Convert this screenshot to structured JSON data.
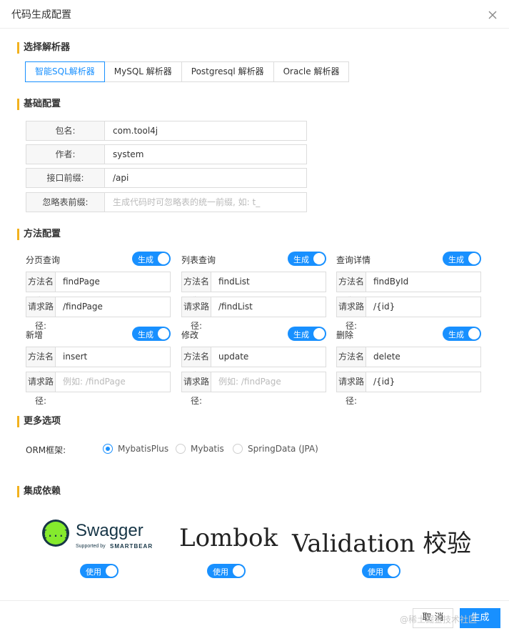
{
  "dialog": {
    "title": "代码生成配置"
  },
  "sections": {
    "parser": "选择解析器",
    "basic": "基础配置",
    "methods": "方法配置",
    "more": "更多选项",
    "deps": "集成依赖"
  },
  "parsers": [
    "智能SQL解析器",
    "MySQL 解析器",
    "Postgresql 解析器",
    "Oracle 解析器"
  ],
  "basic": {
    "package": {
      "label": "包名:",
      "value": "com.tool4j"
    },
    "author": {
      "label": "作者:",
      "value": "system"
    },
    "prefix": {
      "label": "接口前缀:",
      "value": "/api"
    },
    "ignore": {
      "label": "忽略表前缀:",
      "placeholder": "生成代码时可忽略表的统一前缀, 如: t_"
    }
  },
  "labels": {
    "method_name": "方法名称:",
    "request_path": "请求路径:",
    "generate": "生成",
    "use": "使用"
  },
  "methods": [
    {
      "title": "分页查询",
      "name": "findPage",
      "path": "/findPage",
      "path_placeholder": ""
    },
    {
      "title": "列表查询",
      "name": "findList",
      "path": "/findList",
      "path_placeholder": ""
    },
    {
      "title": "查询详情",
      "name": "findById",
      "path": "/{id}",
      "path_placeholder": ""
    },
    {
      "title": "新增",
      "name": "insert",
      "path": "",
      "path_placeholder": "例如: /findPage"
    },
    {
      "title": "修改",
      "name": "update",
      "path": "",
      "path_placeholder": "例如: /findPage"
    },
    {
      "title": "删除",
      "name": "delete",
      "path": "/{id}",
      "path_placeholder": ""
    }
  ],
  "orm": {
    "label": "ORM框架:",
    "options": [
      "MybatisPlus",
      "Mybatis",
      "SpringData (JPA)"
    ],
    "selected": "MybatisPlus"
  },
  "deps": {
    "swagger": {
      "name": "Swagger",
      "sub": "Supported by",
      "brand": "SMARTBEAR",
      "badge": "{...}"
    },
    "lombok": "Lombok",
    "validation": "Validation 校验"
  },
  "footer": {
    "cancel": "取 消",
    "generate": "生成"
  },
  "watermark": "@稀土掘金技术社区",
  "colors": {
    "primary": "#1890ff",
    "accent": "#f2b21f",
    "swagger_green": "#85ea2d"
  }
}
